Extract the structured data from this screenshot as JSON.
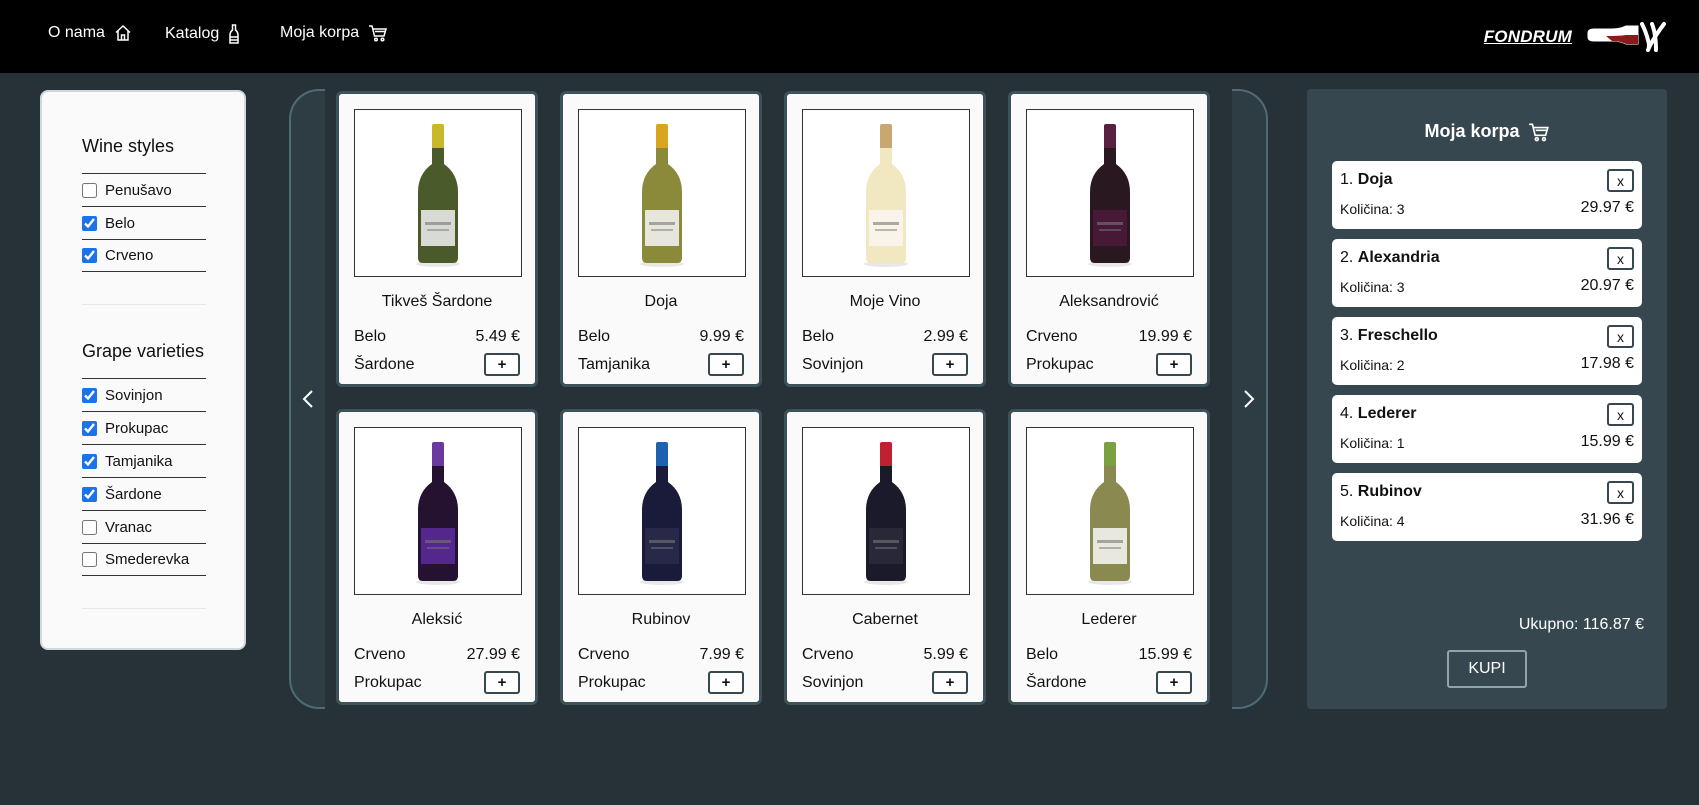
{
  "nav": {
    "about_label": "O nama",
    "catalog_label": "Katalog",
    "cart_label": "Moja korpa",
    "brand": "FONDRUM"
  },
  "filters": {
    "wine_styles": {
      "title": "Wine styles",
      "options": [
        {
          "label": "Penušavo",
          "checked": false
        },
        {
          "label": "Belo",
          "checked": true
        },
        {
          "label": "Crveno",
          "checked": true
        }
      ]
    },
    "grape_varieties": {
      "title": "Grape varieties",
      "options": [
        {
          "label": "Sovinjon",
          "checked": true
        },
        {
          "label": "Prokupac",
          "checked": true
        },
        {
          "label": "Tamjanika",
          "checked": true
        },
        {
          "label": "Šardone",
          "checked": true
        },
        {
          "label": "Vranac",
          "checked": false
        },
        {
          "label": "Smederevka",
          "checked": false
        }
      ]
    }
  },
  "products": [
    {
      "name": "Tikveš Šardone",
      "style": "Belo",
      "price": "5.49 €",
      "grape": "Šardone",
      "add_label": "+",
      "bottle_color": "#4a5a2a",
      "cap_color": "#c9b82a",
      "label_color": "#e8e8e8"
    },
    {
      "name": "Doja",
      "style": "Belo",
      "price": "9.99 €",
      "grape": "Tamjanika",
      "add_label": "+",
      "bottle_color": "#8a8a3a",
      "cap_color": "#d9a520",
      "label_color": "#f0f0f0"
    },
    {
      "name": "Moje Vino",
      "style": "Belo",
      "price": "2.99 €",
      "grape": "Sovinjon",
      "add_label": "+",
      "bottle_color": "#f1e7c0",
      "cap_color": "#c8a870",
      "label_color": "#fbf4ee"
    },
    {
      "name": "Aleksandrović",
      "style": "Crveno",
      "price": "19.99 €",
      "grape": "Prokupac",
      "add_label": "+",
      "bottle_color": "#2a1820",
      "cap_color": "#5a2040",
      "label_color": "#4a1a3a"
    },
    {
      "name": "Aleksić",
      "style": "Crveno",
      "price": "27.99 €",
      "grape": "Prokupac",
      "add_label": "+",
      "bottle_color": "#241230",
      "cap_color": "#6a3aa0",
      "label_color": "#5a2a9a"
    },
    {
      "name": "Rubinov",
      "style": "Crveno",
      "price": "7.99 €",
      "grape": "Prokupac",
      "add_label": "+",
      "bottle_color": "#1a1a3a",
      "cap_color": "#2060b0",
      "label_color": "#2a2a4a"
    },
    {
      "name": "Cabernet",
      "style": "Crveno",
      "price": "5.99 €",
      "grape": "Sovinjon",
      "add_label": "+",
      "bottle_color": "#1a1a2a",
      "cap_color": "#c02030",
      "label_color": "#2a2a3a"
    },
    {
      "name": "Lederer",
      "style": "Belo",
      "price": "15.99 €",
      "grape": "Šardone",
      "add_label": "+",
      "bottle_color": "#8a8a50",
      "cap_color": "#7aa040",
      "label_color": "#f2f2ee"
    }
  ],
  "cart": {
    "title": "Moja korpa",
    "items": [
      {
        "index": "1.",
        "name": "Doja",
        "qty": "Količina: 3",
        "price": "29.97 €",
        "remove_label": "x"
      },
      {
        "index": "2.",
        "name": "Alexandria",
        "qty": "Količina: 3",
        "price": "20.97 €",
        "remove_label": "x"
      },
      {
        "index": "3.",
        "name": "Freschello",
        "qty": "Količina: 2",
        "price": "17.98 €",
        "remove_label": "x"
      },
      {
        "index": "4.",
        "name": "Lederer",
        "qty": "Količina: 1",
        "price": "15.99 €",
        "remove_label": "x"
      },
      {
        "index": "5.",
        "name": "Rubinov",
        "qty": "Količina: 4",
        "price": "31.96 €",
        "remove_label": "x"
      }
    ],
    "total": "Ukupno: 116.87 €",
    "buy_label": "KUPI"
  }
}
